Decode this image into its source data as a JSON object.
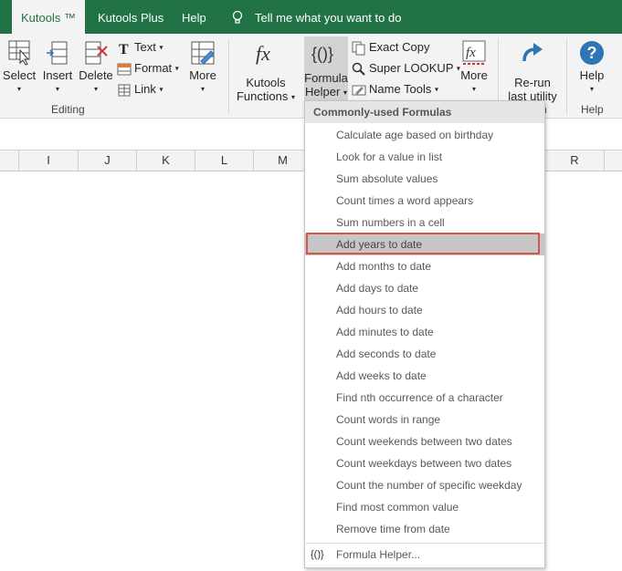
{
  "tabs": [
    {
      "label": "Kutools ™",
      "active": true
    },
    {
      "label": "Kutools Plus"
    },
    {
      "label": "Help"
    }
  ],
  "tell_me": "Tell me what you want to do",
  "ribbon": {
    "select": "Select",
    "insert": "Insert",
    "delete": "Delete",
    "text": "Text",
    "format": "Format",
    "link": "Link",
    "more1": "More",
    "editing_group": "Editing",
    "kutools_functions_1": "Kutools",
    "kutools_functions_2": "Functions",
    "formula_helper_1": "Formula",
    "formula_helper_2": "Helper",
    "exact_copy": "Exact Copy",
    "super_lookup": "Super LOOKUP",
    "name_tools": "Name Tools",
    "more2": "More",
    "rerun_1": "Re-run",
    "rerun_2": "last utility",
    "help": "Help",
    "help_group": "Help",
    "n_group": "n"
  },
  "columns": [
    "I",
    "J",
    "K",
    "L",
    "M",
    "R"
  ],
  "dropdown": {
    "header": "Commonly-used Formulas",
    "items": [
      "Calculate age based on birthday",
      "Look for a value in list",
      "Sum absolute values",
      "Count times a word appears",
      "Sum numbers in a cell",
      "Add years to date",
      "Add months to date",
      "Add days to date",
      "Add hours to date",
      "Add minutes to date",
      "Add seconds to date",
      "Add weeks to date",
      "Find nth occurrence of a character",
      "Count words in range",
      "Count weekends between two dates",
      "Count weekdays between two dates",
      "Count the number of specific weekday",
      "Find most common value",
      "Remove time from date"
    ],
    "selected_item": "Add years to date",
    "footer_icon": "{()}",
    "footer": "Formula Helper..."
  },
  "colors": {
    "excel_green": "#217346",
    "highlight_border": "#d9534f",
    "ribbon_bg": "#f3f3f3"
  }
}
